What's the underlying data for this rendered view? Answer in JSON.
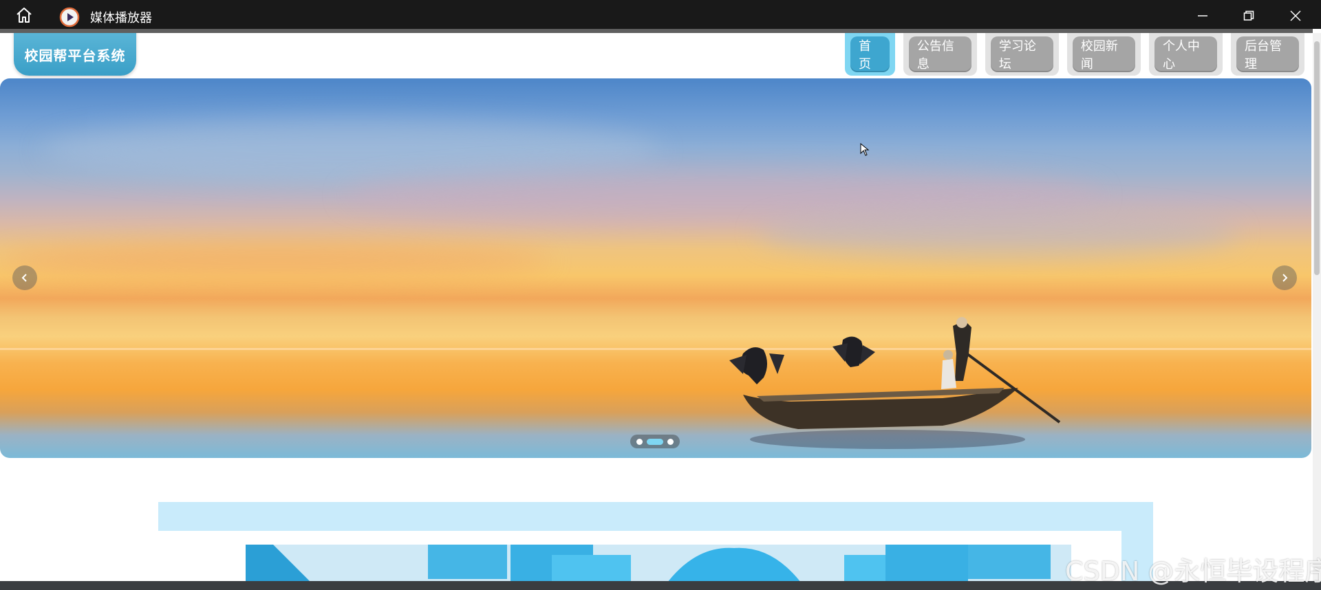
{
  "window": {
    "title": "媒体播放器",
    "icons": {
      "home": "home-icon",
      "app": "play-icon",
      "minimize": "minimize-icon",
      "maximize": "maximize-icon",
      "close": "close-icon"
    }
  },
  "site": {
    "logo_text": "校园帮平台系统",
    "nav": [
      {
        "label": "首页",
        "active": true
      },
      {
        "label": "公告信息",
        "active": false
      },
      {
        "label": "学习论坛",
        "active": false
      },
      {
        "label": "校园新闻",
        "active": false
      },
      {
        "label": "个人中心",
        "active": false
      },
      {
        "label": "后台管理",
        "active": false
      }
    ],
    "carousel": {
      "icons": {
        "prev": "chevron-left-icon",
        "next": "chevron-right-icon"
      },
      "slide_count": 3,
      "active_slide": 2
    }
  },
  "watermark": "CSDN @永恒毕设程序",
  "colors": {
    "accent": "#3ea6cf",
    "accent_light": "#7fd6f2",
    "nav_inactive": "#a5a5a5",
    "titlebar": "#191919"
  }
}
